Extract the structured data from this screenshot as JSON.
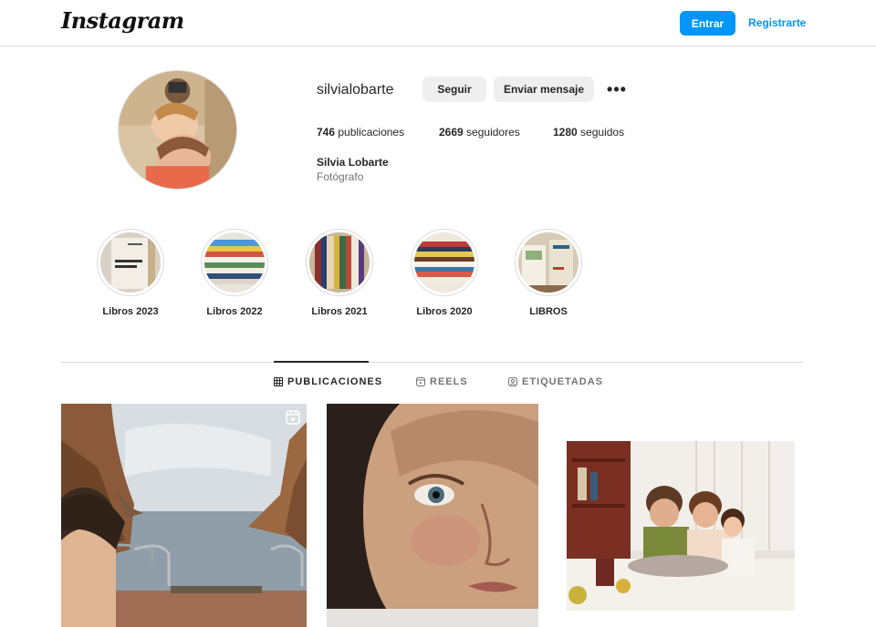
{
  "header": {
    "logo_text": "Instagram",
    "login_label": "Entrar",
    "signup_label": "Registrarte"
  },
  "profile": {
    "username": "silvialobarte",
    "follow_label": "Seguir",
    "message_label": "Enviar mensaje",
    "more_icon": "more-options-icon",
    "posts_count": "746",
    "posts_label": "publicaciones",
    "followers_count": "2669",
    "followers_label": "seguidores",
    "following_count": "1280",
    "following_label": "seguidos",
    "full_name": "Silvia Lobarte",
    "category": "Fotógrafo"
  },
  "highlights": [
    {
      "label": "Libros 2023"
    },
    {
      "label": "Libros 2022"
    },
    {
      "label": "Libros 2021"
    },
    {
      "label": "Libros 2020"
    },
    {
      "label": "LIBROS"
    }
  ],
  "tabs": [
    {
      "label": "PUBLICACIONES",
      "icon": "grid-icon",
      "active": true
    },
    {
      "label": "REELS",
      "icon": "reels-icon",
      "active": false
    },
    {
      "label": "ETIQUETADAS",
      "icon": "tagged-icon",
      "active": false
    }
  ],
  "colors": {
    "accent": "#0095f6",
    "text": "#262626",
    "muted": "#737373",
    "border": "#dbdbdb",
    "button_gray": "#efefef"
  }
}
